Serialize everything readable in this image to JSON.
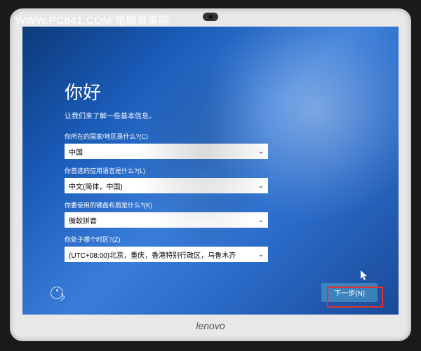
{
  "watermark": "WWW.PC841.COM 电脑百事网",
  "brand": "lenovo",
  "oobe": {
    "title": "你好",
    "subtitle": "让我们来了解一些基本信息。",
    "fields": {
      "country": {
        "label": "你所在的国家/地区是什么?(C)",
        "value": "中国"
      },
      "language": {
        "label": "你首选的应用语言是什么?(L)",
        "value": "中文(简体，中国)"
      },
      "keyboard": {
        "label": "你要使用的键盘布局是什么?(K)",
        "value": "微软拼音"
      },
      "timezone": {
        "label": "你处于哪个时区?(Z)",
        "value": "(UTC+08:00)北京，重庆，香港特别行政区，乌鲁木齐"
      }
    },
    "next_label": "下一步(N)"
  }
}
